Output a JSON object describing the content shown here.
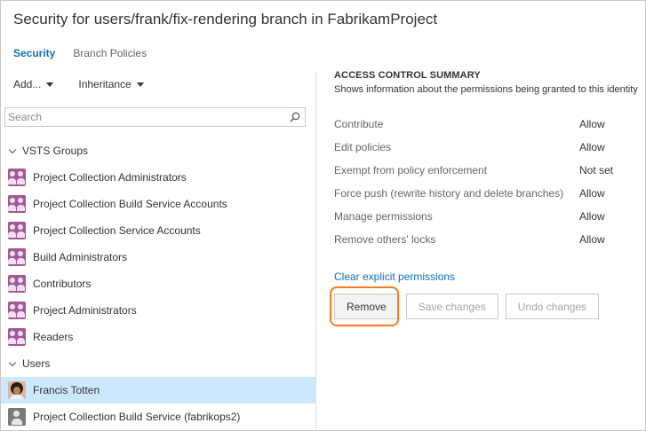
{
  "page": {
    "title": "Security for users/frank/fix-rendering branch in FabrikamProject"
  },
  "tabs": [
    {
      "label": "Security",
      "active": true
    },
    {
      "label": "Branch Policies",
      "active": false
    }
  ],
  "toolbar": {
    "add_label": "Add...",
    "inheritance_label": "Inheritance"
  },
  "search": {
    "placeholder": "Search"
  },
  "groups": {
    "vsts_label": "VSTS Groups",
    "vsts_items": [
      "Project Collection Administrators",
      "Project Collection Build Service Accounts",
      "Project Collection Service Accounts",
      "Build Administrators",
      "Contributors",
      "Project Administrators",
      "Readers"
    ],
    "users_label": "Users",
    "users_items": [
      {
        "name": "Francis Totten",
        "selected": true,
        "icon": "user-avatar"
      },
      {
        "name": "Project Collection Build Service (fabrikops2)",
        "selected": false,
        "icon": "service-account-icon"
      }
    ]
  },
  "summary": {
    "title": "ACCESS CONTROL SUMMARY",
    "subtitle": "Shows information about the permissions being granted to this identity",
    "permissions": [
      {
        "name": "Contribute",
        "value": "Allow"
      },
      {
        "name": "Edit policies",
        "value": "Allow"
      },
      {
        "name": "Exempt from policy enforcement",
        "value": "Not set"
      },
      {
        "name": "Force push (rewrite history and delete branches)",
        "value": "Allow"
      },
      {
        "name": "Manage permissions",
        "value": "Allow"
      },
      {
        "name": "Remove others' locks",
        "value": "Allow"
      }
    ],
    "clear_link": "Clear explicit permissions",
    "buttons": {
      "remove": "Remove",
      "save": "Save changes",
      "undo": "Undo changes"
    }
  },
  "colors": {
    "accent": "#106ebe",
    "selected_row": "#cce8ff",
    "highlight": "#f47b20",
    "group_icon": "#a3589a"
  }
}
